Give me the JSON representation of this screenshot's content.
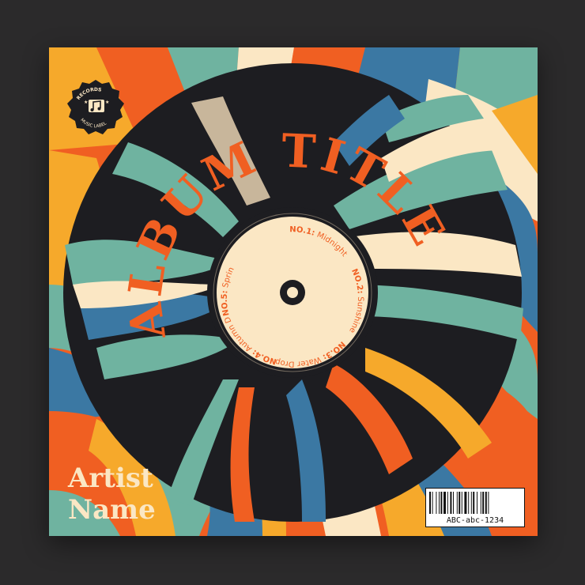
{
  "album": {
    "title": "ALBUM TITLE",
    "artist_line1": "Artist",
    "artist_line2": "Name"
  },
  "label_logo": {
    "top_text": "RECORDS",
    "bottom_text": "MUSIC LABEL",
    "icon": "music-note-icon"
  },
  "tracklist": [
    {
      "no": "NO.1:",
      "name": "Midnight"
    },
    {
      "no": "NO.2:",
      "name": "Sunshine"
    },
    {
      "no": "NO.3:",
      "name": "Water Drops"
    },
    {
      "no": "NO.4:",
      "name": "Autumn Dance"
    },
    {
      "no": "NO.5:",
      "name": "Spring Chant"
    }
  ],
  "barcode": {
    "code": "ABC-abc-1234"
  },
  "colors": {
    "orange": "#f05f22",
    "teal": "#6fb3a0",
    "blue": "#3b78a3",
    "cream": "#fbe7c4",
    "yellow": "#f6a92b",
    "black": "#1d1d21",
    "beige": "#c8b69b"
  }
}
